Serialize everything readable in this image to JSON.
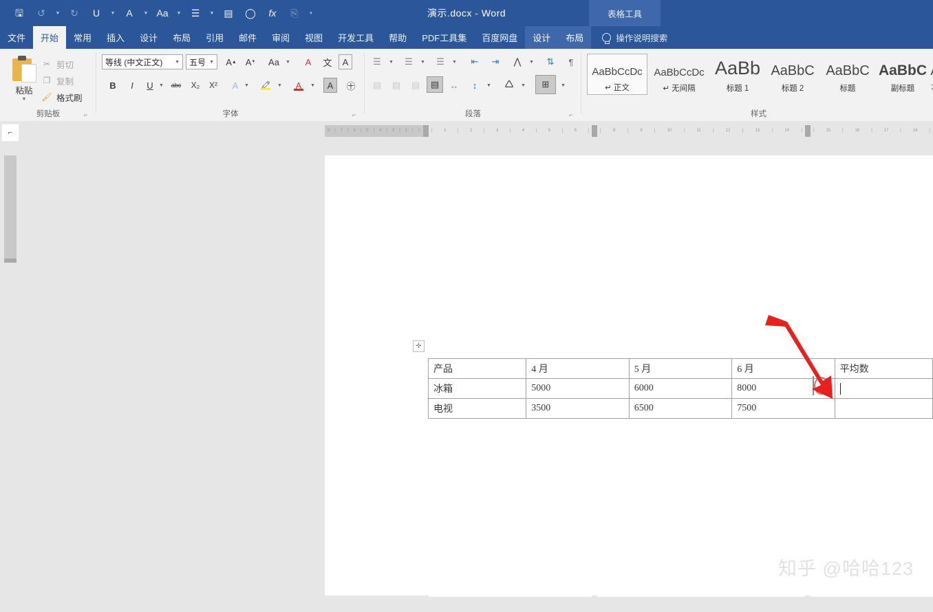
{
  "titlebar": {
    "document_title": "演示.docx  -  Word",
    "contextual_tools": "表格工具",
    "quick_access": [
      {
        "name": "save-icon",
        "glyph": "🖫"
      },
      {
        "name": "undo-icon",
        "glyph": "↺"
      },
      {
        "name": "redo-icon",
        "glyph": "↻"
      },
      {
        "name": "underline-icon",
        "glyph": "U"
      },
      {
        "name": "font-color-icon",
        "glyph": "A"
      },
      {
        "name": "change-case-icon",
        "glyph": "Aa"
      },
      {
        "name": "bullets-icon",
        "glyph": "☰"
      },
      {
        "name": "paragraph-shading-icon",
        "glyph": "▤"
      },
      {
        "name": "circle-icon",
        "glyph": "◯"
      },
      {
        "name": "formula-icon",
        "glyph": "fx"
      },
      {
        "name": "screenshot-icon",
        "glyph": "⎘"
      },
      {
        "name": "more-commands-icon",
        "glyph": "▾"
      }
    ]
  },
  "tabs": [
    {
      "label": "文件",
      "state": "file"
    },
    {
      "label": "开始",
      "state": "active"
    },
    {
      "label": "常用",
      "state": "normal"
    },
    {
      "label": "插入",
      "state": "normal"
    },
    {
      "label": "设计",
      "state": "normal"
    },
    {
      "label": "布局",
      "state": "normal"
    },
    {
      "label": "引用",
      "state": "normal"
    },
    {
      "label": "邮件",
      "state": "normal"
    },
    {
      "label": "审阅",
      "state": "normal"
    },
    {
      "label": "视图",
      "state": "normal"
    },
    {
      "label": "开发工具",
      "state": "normal"
    },
    {
      "label": "帮助",
      "state": "normal"
    },
    {
      "label": "PDF工具集",
      "state": "normal"
    },
    {
      "label": "百度网盘",
      "state": "normal"
    },
    {
      "label": "设计",
      "state": "ctx"
    },
    {
      "label": "布局",
      "state": "ctx"
    }
  ],
  "tell_me": "操作说明搜索",
  "ribbon": {
    "clipboard": {
      "group_label": "剪贴板",
      "paste_label": "粘贴",
      "items": [
        {
          "label": "剪切",
          "icon": "scissors-icon",
          "glyph": "✂",
          "enabled": false
        },
        {
          "label": "复制",
          "icon": "copy-icon",
          "glyph": "❐",
          "enabled": false
        },
        {
          "label": "格式刷",
          "icon": "format-painter-icon",
          "glyph": "🖌",
          "enabled": true
        }
      ]
    },
    "font": {
      "group_label": "字体",
      "font_name": "等线 (中文正文)",
      "font_size": "五号",
      "row1": [
        {
          "name": "grow-font-icon",
          "glyph": "A⁺"
        },
        {
          "name": "shrink-font-icon",
          "glyph": "A⁻"
        },
        {
          "name": "change-case-icon",
          "glyph": "Aa"
        },
        {
          "name": "clear-formatting-icon",
          "glyph": "A"
        },
        {
          "name": "phonetic-guide-icon",
          "glyph": "文"
        },
        {
          "name": "character-border-icon",
          "glyph": "A"
        }
      ],
      "row2": [
        {
          "name": "bold-icon",
          "glyph": "B"
        },
        {
          "name": "italic-icon",
          "glyph": "I"
        },
        {
          "name": "underline-icon",
          "glyph": "U"
        },
        {
          "name": "strikethrough-icon",
          "glyph": "abc"
        },
        {
          "name": "subscript-icon",
          "glyph": "X₂"
        },
        {
          "name": "superscript-icon",
          "glyph": "X²"
        },
        {
          "name": "text-effects-icon",
          "glyph": "A"
        },
        {
          "name": "highlight-color-icon",
          "glyph": "🖍"
        },
        {
          "name": "font-color-icon",
          "glyph": "A"
        },
        {
          "name": "character-shading-icon",
          "glyph": "A"
        },
        {
          "name": "enclose-character-icon",
          "glyph": "㊉"
        }
      ]
    },
    "paragraph": {
      "group_label": "段落",
      "row1": [
        {
          "name": "bullets-icon",
          "glyph": "☰"
        },
        {
          "name": "numbering-icon",
          "glyph": "☰"
        },
        {
          "name": "multilevel-list-icon",
          "glyph": "☰"
        },
        {
          "name": "decrease-indent-icon",
          "glyph": "⇤"
        },
        {
          "name": "increase-indent-icon",
          "glyph": "⇥"
        },
        {
          "name": "asian-layout-icon",
          "glyph": "⋀"
        },
        {
          "name": "sort-icon",
          "glyph": "↓"
        },
        {
          "name": "show-marks-icon",
          "glyph": "¶"
        }
      ],
      "row2": [
        {
          "name": "align-left-icon",
          "glyph": "▤"
        },
        {
          "name": "align-center-icon",
          "glyph": "▤"
        },
        {
          "name": "align-right-icon",
          "glyph": "▤"
        },
        {
          "name": "justify-icon",
          "glyph": "▤"
        },
        {
          "name": "distribute-icon",
          "glyph": "↔"
        },
        {
          "name": "line-spacing-icon",
          "glyph": "↕"
        },
        {
          "name": "shading-icon",
          "glyph": "🛆"
        },
        {
          "name": "borders-icon",
          "glyph": "⊞"
        }
      ]
    },
    "styles": {
      "group_label": "样式",
      "items": [
        {
          "preview": "AaBbCcDc",
          "name": "正文",
          "size": 15,
          "weight": "400",
          "selected": true,
          "mark": "↵"
        },
        {
          "preview": "AaBbCcDc",
          "name": "无间隔",
          "size": 15,
          "weight": "400",
          "selected": false,
          "mark": "↵"
        },
        {
          "preview": "AaBb",
          "name": "标题 1",
          "size": 27,
          "weight": "400",
          "selected": false,
          "mark": ""
        },
        {
          "preview": "AaBbC",
          "name": "标题 2",
          "size": 20,
          "weight": "400",
          "selected": false,
          "mark": ""
        },
        {
          "preview": "AaBbC",
          "name": "标题",
          "size": 20,
          "weight": "400",
          "selected": false,
          "mark": ""
        },
        {
          "preview": "AaBbC",
          "name": "副标题",
          "size": 21,
          "weight": "700",
          "selected": false,
          "mark": ""
        },
        {
          "preview": "A",
          "name": "不",
          "size": 20,
          "weight": "400",
          "selected": false,
          "mark": ""
        }
      ]
    }
  },
  "document": {
    "table": {
      "headers": [
        "产品",
        "4 月",
        "5 月",
        "6 月",
        "平均数"
      ],
      "rows": [
        {
          "cells": [
            "冰箱",
            "5000",
            "6000",
            "8000",
            ""
          ]
        },
        {
          "cells": [
            "电视",
            "3500",
            "6500",
            "7500",
            ""
          ]
        }
      ]
    },
    "annotation": {
      "arrow_color": "#e8201e",
      "circle_color": "#e06a6a",
      "target": "平均数 cell of 冰箱 row"
    }
  },
  "watermark": "知乎 @哈哈123",
  "colors": {
    "titlebar": "#2b579a",
    "contextual": "#3f68ab",
    "ribbon_bg": "#f2f2f2",
    "workspace": "#e6e6e6",
    "page": "#ffffff",
    "accent_red": "#e8201e"
  }
}
